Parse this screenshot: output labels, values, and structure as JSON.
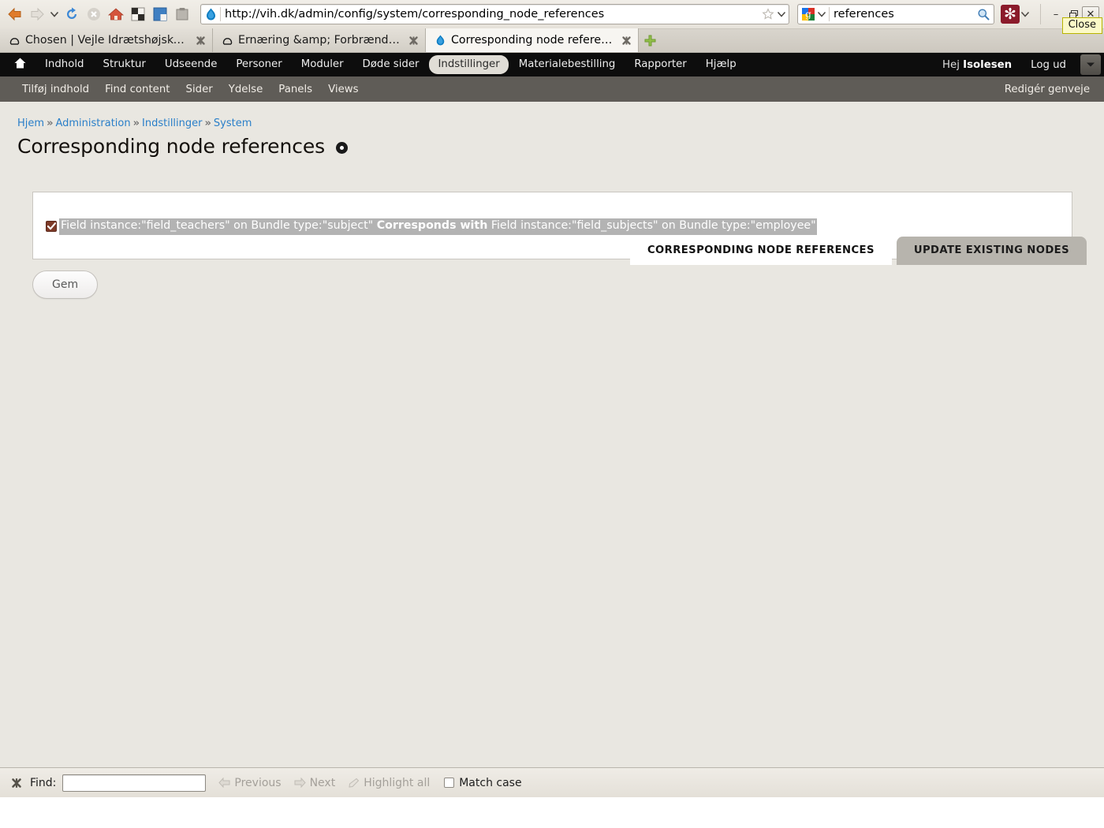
{
  "browser": {
    "toolbar_icons": [
      {
        "name": "back-button",
        "label": "Back"
      },
      {
        "name": "forward-button",
        "label": "Forward"
      },
      {
        "name": "history-dropdown",
        "label": "Recent pages"
      },
      {
        "name": "reload-button",
        "label": "Reload"
      },
      {
        "name": "stop-button",
        "label": "Stop"
      },
      {
        "name": "home-button",
        "label": "Home"
      },
      {
        "name": "downloads-button",
        "label": "Downloads"
      },
      {
        "name": "sidebar-button",
        "label": "Sidebar"
      },
      {
        "name": "clipboard-button",
        "label": "Clipboard"
      }
    ],
    "url": "http://vih.dk/admin/config/system/corresponding_node_references",
    "url_favicon": "drupal-drop-icon",
    "bookmark_star": "star-icon",
    "search": {
      "engine_icon": "google-icon",
      "value": "references",
      "go_icon": "magnifier-icon"
    },
    "addon_button_label": "✻",
    "window_controls": {
      "minimize": "–",
      "restore": "❐",
      "close": "✕",
      "tooltip": "Close"
    },
    "tabs": [
      {
        "favicon": "page-icon",
        "title": "Chosen | Vejle Idrætshøjskole",
        "active": false
      },
      {
        "favicon": "page-icon",
        "title": "Ernæring &amp; Forbrændi...",
        "active": false
      },
      {
        "favicon": "drupal-drop-icon",
        "title": "Corresponding node referen...",
        "active": true
      }
    ],
    "new_tab_label": "+"
  },
  "admin_menu": {
    "home_icon": "house-icon",
    "items": [
      {
        "label": "Indhold",
        "active": false
      },
      {
        "label": "Struktur",
        "active": false
      },
      {
        "label": "Udseende",
        "active": false
      },
      {
        "label": "Personer",
        "active": false
      },
      {
        "label": "Moduler",
        "active": false
      },
      {
        "label": "Døde sider",
        "active": false
      },
      {
        "label": "Indstillinger",
        "active": true
      },
      {
        "label": "Materialebestilling",
        "active": false
      },
      {
        "label": "Rapporter",
        "active": false
      },
      {
        "label": "Hjælp",
        "active": false
      }
    ],
    "greeting_prefix": "Hej ",
    "username": "Isolesen",
    "logout_label": "Log ud",
    "dropdown_icon": "chevron-down-icon"
  },
  "shortcut_bar": {
    "items": [
      {
        "label": "Tilføj indhold"
      },
      {
        "label": "Find content"
      },
      {
        "label": "Sider"
      },
      {
        "label": "Ydelse"
      },
      {
        "label": "Panels"
      },
      {
        "label": "Views"
      }
    ],
    "edit_label": "Redigér genveje"
  },
  "breadcrumb": {
    "items": [
      "Hjem",
      "Administration",
      "Indstillinger",
      "System"
    ],
    "separator": "»"
  },
  "page": {
    "title": "Corresponding node references",
    "contextual_icon": "gear-icon"
  },
  "local_tasks": [
    {
      "label": "CORRESPONDING NODE REFERENCES",
      "active": true
    },
    {
      "label": "UPDATE EXISTING NODES",
      "active": false
    }
  ],
  "form": {
    "checkbox_checked": true,
    "row_text_part1": "Field instance:\"field_teachers\" on Bundle type:\"subject\" ",
    "row_text_bold": "Corresponds with",
    "row_text_part2": " Field instance:\"field_subjects\" on Bundle type:\"employee\"",
    "save_label": "Gem"
  },
  "findbar": {
    "close_icon": "close-icon",
    "label": "Find:",
    "input_value": "",
    "previous_label": "Previous",
    "next_label": "Next",
    "highlight_label": "Highlight all",
    "match_case_label": "Match case",
    "match_case_checked": false
  },
  "colors": {
    "chrome_bg": "#ece9e3",
    "admin_bar": "#0d0d0d",
    "shortcut_bar": "#5f5c57",
    "page_bg": "#e9e7e1",
    "link": "#2a7fc9",
    "selection_highlight": "#b3b3b3",
    "checkbox": "#7d3a28",
    "addon": "#8b1b2b",
    "tooltip_bg": "#fbf9c8"
  }
}
